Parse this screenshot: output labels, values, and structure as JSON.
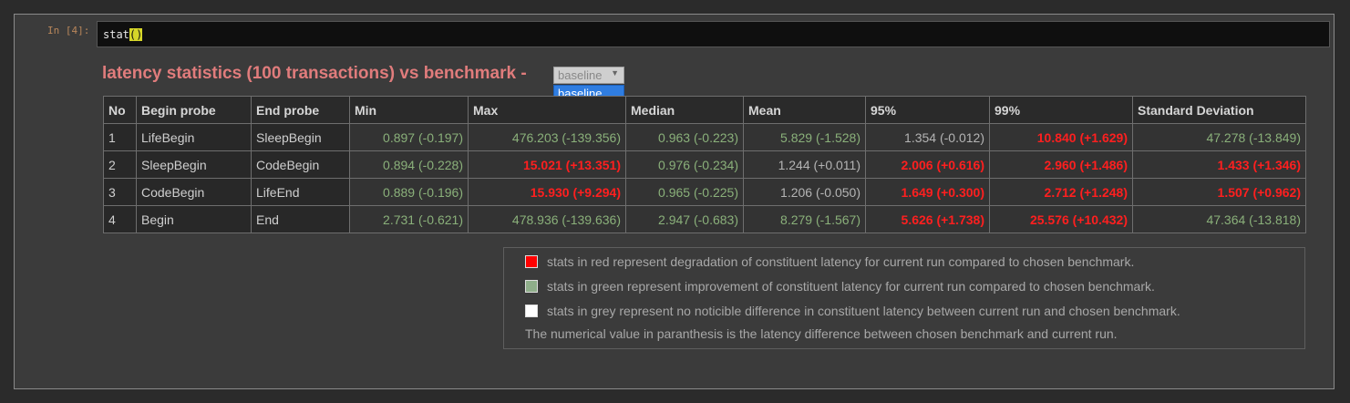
{
  "notebook": {
    "prompt": "In [4]:",
    "code": "stat",
    "code_parens": "()"
  },
  "report": {
    "title": "latency statistics (100 transactions) vs benchmark -",
    "benchmark_select": {
      "selected": "baseline",
      "options": [
        "baseline"
      ]
    }
  },
  "table": {
    "headers": [
      "No",
      "Begin probe",
      "End probe",
      "Min",
      "Max",
      "Median",
      "Mean",
      "95%",
      "99%",
      "Standard Deviation"
    ],
    "rows": [
      {
        "cells": [
          "1",
          "LifeBegin",
          "SleepBegin",
          "0.897 (-0.197)",
          "476.203 (-139.356)",
          "0.963 (-0.223)",
          "5.829 (-1.528)",
          "1.354 (-0.012)",
          "10.840 (+1.629)",
          "47.278 (-13.849)"
        ],
        "status": [
          "",
          "",
          "",
          "green",
          "green",
          "green",
          "green",
          "grey",
          "red",
          "green"
        ]
      },
      {
        "cells": [
          "2",
          "SleepBegin",
          "CodeBegin",
          "0.894 (-0.228)",
          "15.021 (+13.351)",
          "0.976 (-0.234)",
          "1.244 (+0.011)",
          "2.006 (+0.616)",
          "2.960 (+1.486)",
          "1.433 (+1.346)"
        ],
        "status": [
          "",
          "",
          "",
          "green",
          "red",
          "green",
          "grey",
          "red",
          "red",
          "red"
        ]
      },
      {
        "cells": [
          "3",
          "CodeBegin",
          "LifeEnd",
          "0.889 (-0.196)",
          "15.930 (+9.294)",
          "0.965 (-0.225)",
          "1.206 (-0.050)",
          "1.649 (+0.300)",
          "2.712 (+1.248)",
          "1.507 (+0.962)"
        ],
        "status": [
          "",
          "",
          "",
          "green",
          "red",
          "green",
          "grey",
          "red",
          "red",
          "red"
        ]
      },
      {
        "cells": [
          "4",
          "Begin",
          "End",
          "2.731 (-0.621)",
          "478.936 (-139.636)",
          "2.947 (-0.683)",
          "8.279 (-1.567)",
          "5.626 (+1.738)",
          "25.576 (+10.432)",
          "47.364 (-13.818)"
        ],
        "status": [
          "",
          "",
          "",
          "green",
          "green",
          "green",
          "green",
          "red",
          "red",
          "green"
        ]
      }
    ]
  },
  "legend": {
    "red_text": "stats in red represent degradation of constituent latency for current run compared to chosen benchmark.",
    "green_text": "stats in green represent improvement of constituent latency for current run compared to chosen benchmark.",
    "grey_text": "stats in grey represent no noticible difference in constituent latency between current run and chosen benchmark.",
    "note": "The numerical value in paranthesis is the latency difference between chosen benchmark and current run.",
    "colors": {
      "red": "#ff0000",
      "green": "#8fae8a",
      "grey": "#ffffff"
    }
  },
  "colors": {
    "title": "#e07c7c",
    "improvement": "#8ab07a",
    "degradation": "#ff1f1f",
    "neutral": "#b4b4b4"
  }
}
